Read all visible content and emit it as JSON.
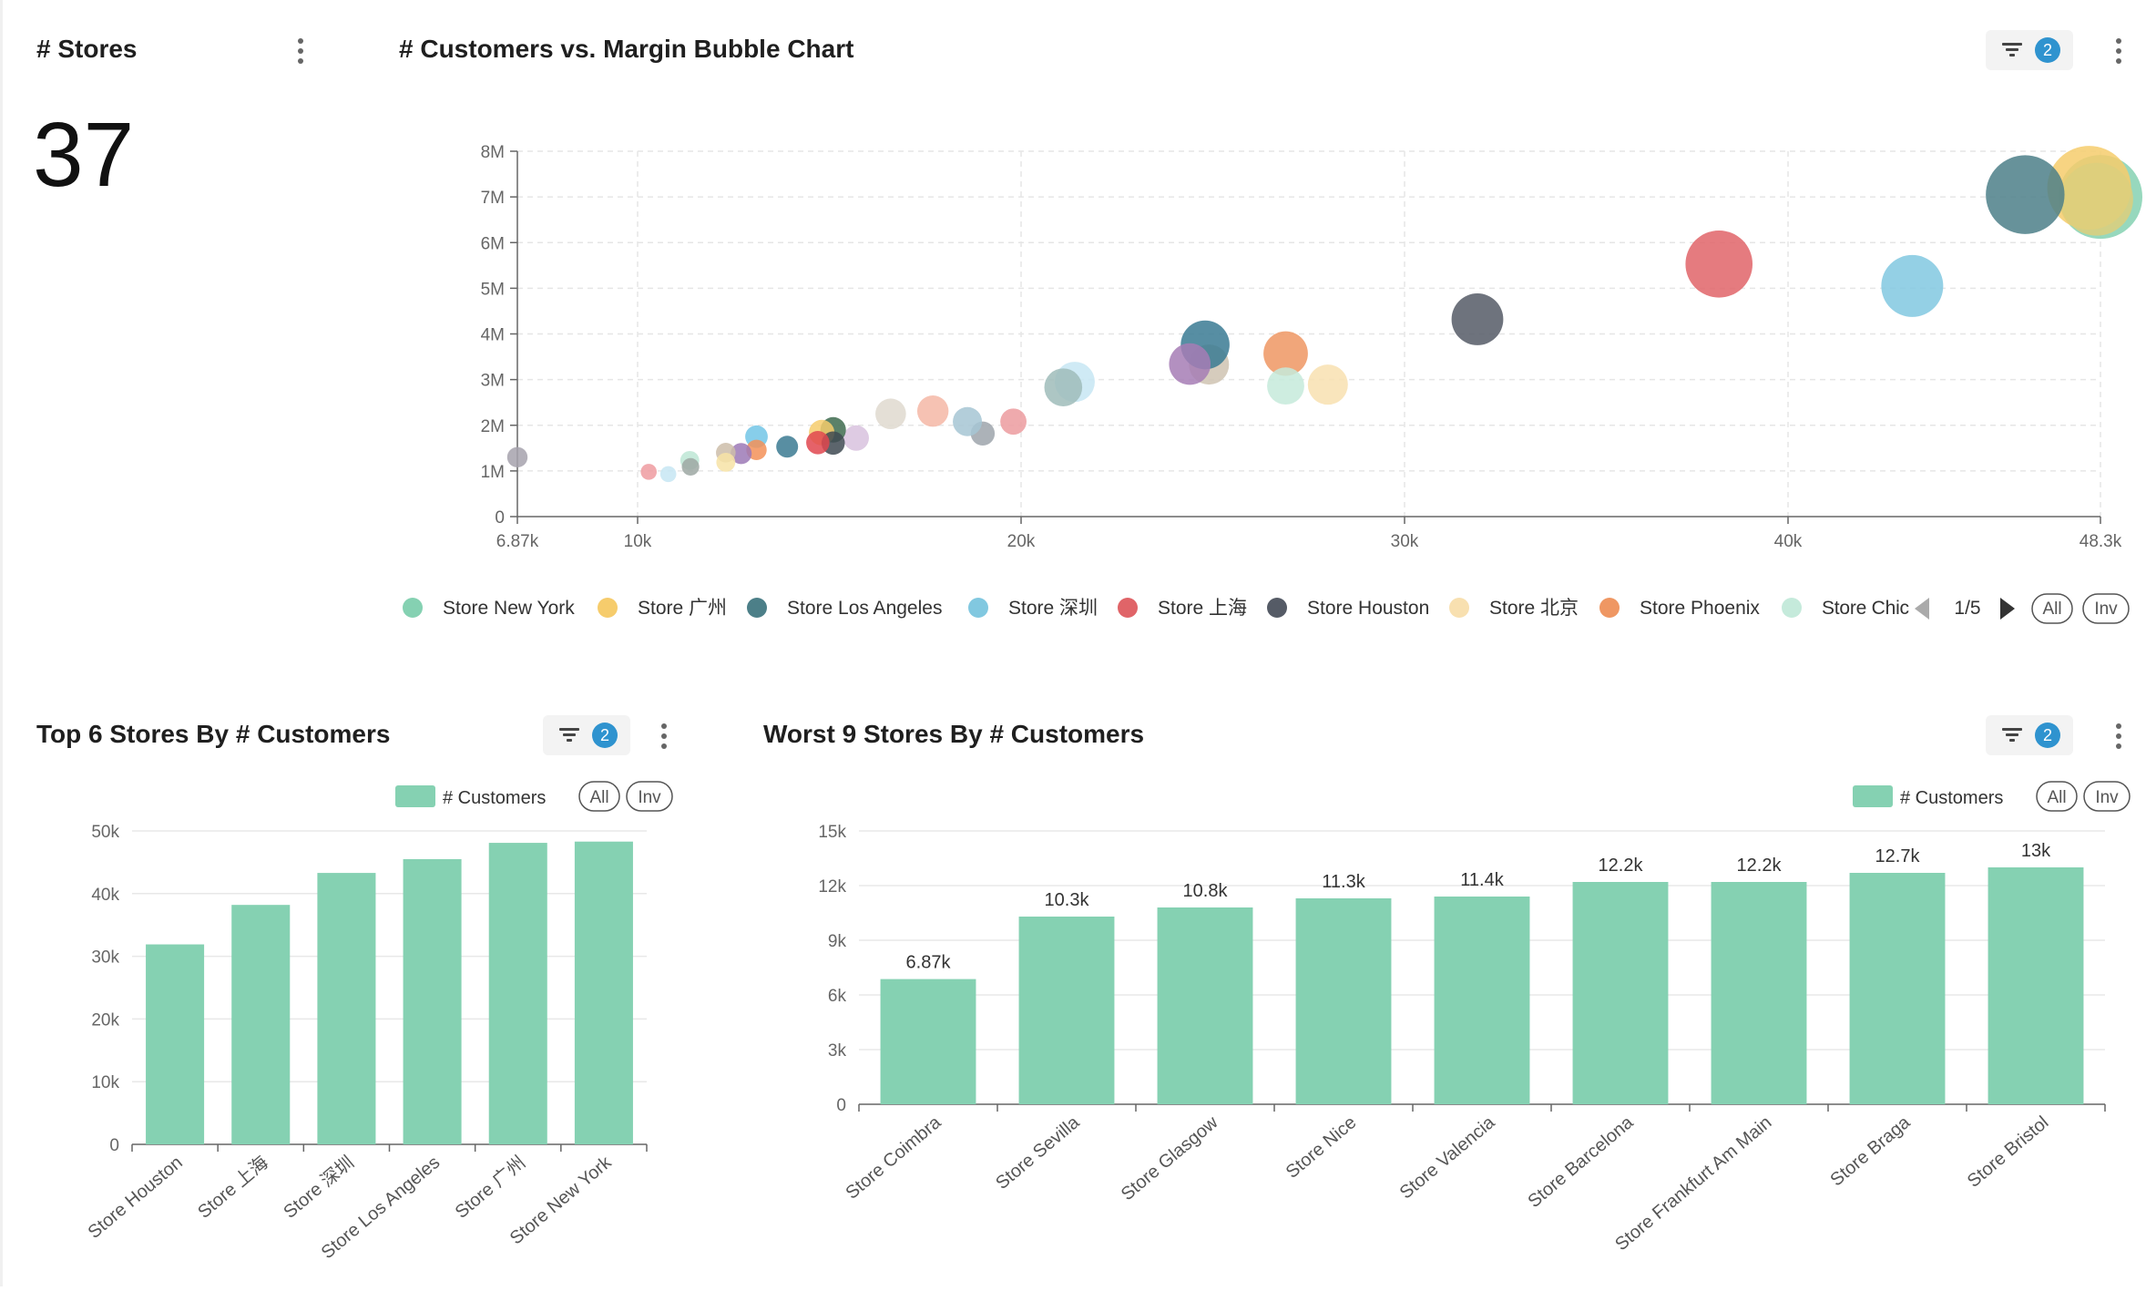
{
  "stores_card": {
    "title": "# Stores",
    "value": "37"
  },
  "bubble_card": {
    "title": "# Customers vs. Margin Bubble Chart",
    "filter_count": "2"
  },
  "top_card": {
    "title": "Top 6 Stores By # Customers",
    "filter_count": "2"
  },
  "worst_card": {
    "title": "Worst 9 Stores By # Customers",
    "filter_count": "2"
  },
  "legend_controls": {
    "all": "All",
    "inv": "Inv",
    "page": "1/5"
  },
  "colors": {
    "accent_badge": "#2f93cf",
    "bar": "#85d1b2"
  },
  "icons": {
    "menu": "kebab-menu-icon",
    "filter": "filter-icon",
    "prev": "arrow-left-icon",
    "next": "arrow-right-icon"
  },
  "chart_data": [
    {
      "type": "scatter",
      "title": "# Customers vs. Margin Bubble Chart",
      "x_ticks": [
        "6.87k",
        "10k",
        "20k",
        "30k",
        "40k",
        "48.3k"
      ],
      "y_ticks": [
        "0",
        "1M",
        "2M",
        "3M",
        "4M",
        "5M",
        "6M",
        "7M",
        "8M"
      ],
      "xlim": [
        6870,
        48300
      ],
      "ylim": [
        0,
        8000000
      ],
      "grid": true,
      "legend_position": "bottom",
      "legend": [
        "Store New York",
        "Store 广州",
        "Store Los Angeles",
        "Store 深圳",
        "Store 上海",
        "Store Houston",
        "Store 北京",
        "Store Phoenix",
        "Store Chic"
      ],
      "points": [
        {
          "x": 48300,
          "y": 7000000,
          "size": 1.0,
          "color": "#85d1b2"
        },
        {
          "x": 48000,
          "y": 7200000,
          "size": 1.0,
          "color": "#f6cc6c"
        },
        {
          "x": 48200,
          "y": 6950000,
          "size": 0.85,
          "color": "#dccf7c"
        },
        {
          "x": 46300,
          "y": 7050000,
          "size": 0.93,
          "color": "#4c7f88"
        },
        {
          "x": 43300,
          "y": 5050000,
          "size": 0.7,
          "color": "#81c8e0"
        },
        {
          "x": 38200,
          "y": 5530000,
          "size": 0.77,
          "color": "#e06468"
        },
        {
          "x": 31900,
          "y": 4320000,
          "size": 0.56,
          "color": "#555b66"
        },
        {
          "x": 28000,
          "y": 2890000,
          "size": 0.4,
          "color": "#f8e0b0"
        },
        {
          "x": 26900,
          "y": 3570000,
          "size": 0.46,
          "color": "#ef9763"
        },
        {
          "x": 26900,
          "y": 2860000,
          "size": 0.36,
          "color": "#c5eadb"
        },
        {
          "x": 24900,
          "y": 3330000,
          "size": 0.4,
          "color": "#cfc3b2"
        },
        {
          "x": 24800,
          "y": 3760000,
          "size": 0.52,
          "color": "#3a7a93"
        },
        {
          "x": 24400,
          "y": 3340000,
          "size": 0.42,
          "color": "#a67db5"
        },
        {
          "x": 21400,
          "y": 2950000,
          "size": 0.4,
          "color": "#c7e6f3"
        },
        {
          "x": 21100,
          "y": 2830000,
          "size": 0.37,
          "color": "#9fbcba"
        },
        {
          "x": 19800,
          "y": 2080000,
          "size": 0.21,
          "color": "#ec9b9f"
        },
        {
          "x": 19000,
          "y": 1820000,
          "size": 0.18,
          "color": "#9ea4ab"
        },
        {
          "x": 18600,
          "y": 2080000,
          "size": 0.25,
          "color": "#a6c6d3"
        },
        {
          "x": 17700,
          "y": 2310000,
          "size": 0.28,
          "color": "#f4b7a6"
        },
        {
          "x": 16600,
          "y": 2250000,
          "size": 0.27,
          "color": "#dfd9cf"
        },
        {
          "x": 15700,
          "y": 1720000,
          "size": 0.2,
          "color": "#d8c2de"
        },
        {
          "x": 15100,
          "y": 1900000,
          "size": 0.2,
          "color": "#3e6b4f"
        },
        {
          "x": 14800,
          "y": 1840000,
          "size": 0.2,
          "color": "#f6cc6c"
        },
        {
          "x": 15100,
          "y": 1610000,
          "size": 0.17,
          "color": "#3f4a52"
        },
        {
          "x": 14700,
          "y": 1620000,
          "size": 0.17,
          "color": "#e0464f"
        },
        {
          "x": 13900,
          "y": 1530000,
          "size": 0.15,
          "color": "#3b7a92"
        },
        {
          "x": 13100,
          "y": 1750000,
          "size": 0.16,
          "color": "#72c6e6"
        },
        {
          "x": 13100,
          "y": 1460000,
          "size": 0.13,
          "color": "#f39058"
        },
        {
          "x": 12700,
          "y": 1380000,
          "size": 0.14,
          "color": "#9c79b6"
        },
        {
          "x": 12300,
          "y": 1400000,
          "size": 0.12,
          "color": "#cdbda9"
        },
        {
          "x": 12300,
          "y": 1190000,
          "size": 0.11,
          "color": "#f7e3a6"
        },
        {
          "x": 11360,
          "y": 1230000,
          "size": 0.11,
          "color": "#bde6d5"
        },
        {
          "x": 11380,
          "y": 1090000,
          "size": 0.09,
          "color": "#9ea8a3"
        },
        {
          "x": 10800,
          "y": 930000,
          "size": 0.07,
          "color": "#c7e6f3"
        },
        {
          "x": 10290,
          "y": 980000,
          "size": 0.07,
          "color": "#ef9ba0"
        },
        {
          "x": 6870,
          "y": 1300000,
          "size": 0.13,
          "color": "#a6a2ad"
        }
      ]
    },
    {
      "type": "bar",
      "title": "Top 6 Stores By # Customers",
      "categories": [
        "Store Houston",
        "Store 上海",
        "Store 深圳",
        "Store Los Angeles",
        "Store 广州",
        "Store New York"
      ],
      "series": [
        {
          "name": "# Customers",
          "values": [
            31900,
            38200,
            43300,
            45500,
            48100,
            48300
          ]
        }
      ],
      "y_ticks": [
        "0",
        "10k",
        "20k",
        "30k",
        "40k",
        "50k"
      ],
      "ylim": [
        0,
        50000
      ],
      "legend_position": "top-right"
    },
    {
      "type": "bar",
      "title": "Worst 9 Stores By # Customers",
      "categories": [
        "Store Coimbra",
        "Store Sevilla",
        "Store Glasgow",
        "Store Nice",
        "Store Valencia",
        "Store Barcelona",
        "Store Frankfurt Am Main",
        "Store Braga",
        "Store Bristol"
      ],
      "series": [
        {
          "name": "# Customers",
          "values": [
            6870,
            10300,
            10800,
            11300,
            11400,
            12200,
            12200,
            12700,
            13000
          ]
        }
      ],
      "labels": [
        "6.87k",
        "10.3k",
        "10.8k",
        "11.3k",
        "11.4k",
        "12.2k",
        "12.2k",
        "12.7k",
        "13k"
      ],
      "y_ticks": [
        "0",
        "3k",
        "6k",
        "9k",
        "12k",
        "15k"
      ],
      "ylim": [
        0,
        15000
      ],
      "legend_position": "top-right"
    }
  ]
}
